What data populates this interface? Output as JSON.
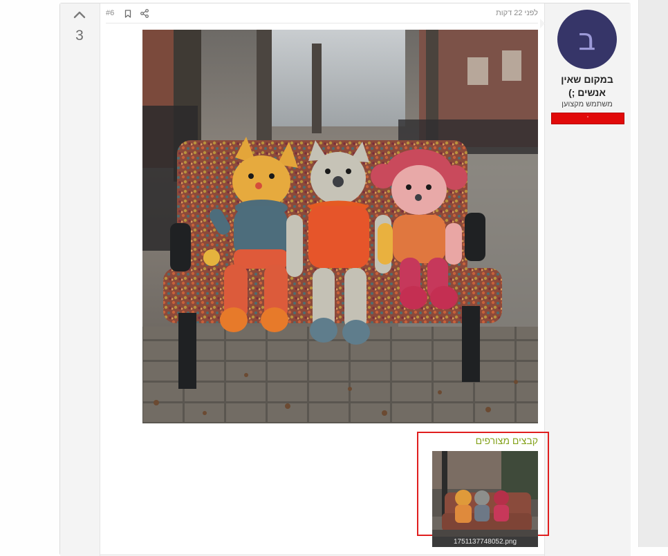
{
  "post": {
    "vote_count": "3",
    "time": "לפני 22 דקות",
    "number": "#6",
    "author": {
      "avatar_letter": "ב",
      "name": "במקום שאין אנשים ;)",
      "title": "משתמש מקצוען",
      "badge": "'",
      "avatar_bg": "#363568",
      "badge_color": "#e10a0a"
    },
    "image_alt": "three knitted toy animals on a yarn-covered bench",
    "attachments": {
      "title": "קבצים מצורפים",
      "files": [
        {
          "name": "1751137748052.png"
        }
      ]
    }
  },
  "icons": {
    "upvote": "chevron-up-icon",
    "bookmark": "bookmark-icon",
    "share": "share-icon"
  },
  "colors": {
    "accent_green": "#84a21b",
    "highlight_red": "#e01e1e"
  }
}
